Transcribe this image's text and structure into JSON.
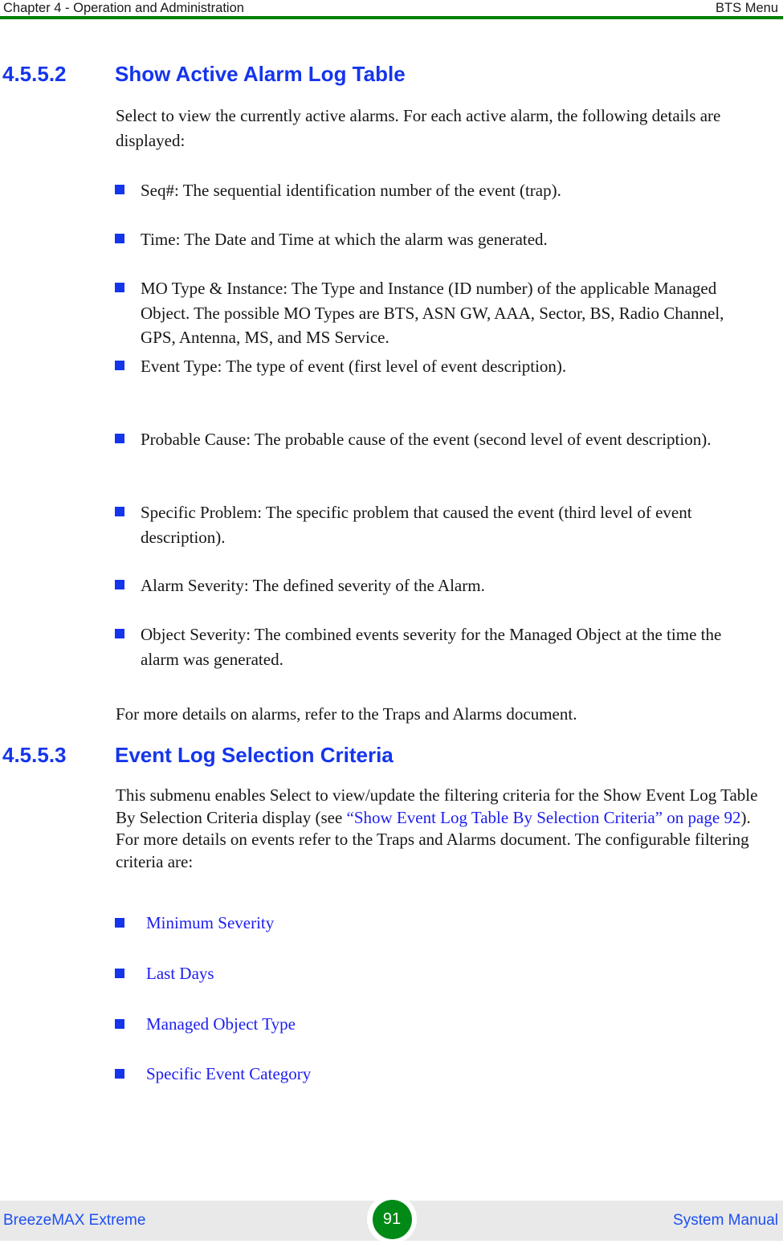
{
  "header": {
    "left": "Chapter 4 - Operation and Administration",
    "right": "BTS Menu",
    "rule_color": "#008000"
  },
  "footer": {
    "left": "BreezeMAX Extreme",
    "right": "System Manual",
    "page_number": "91",
    "badge_color": "#018a16",
    "band_color": "#e9e9e9",
    "link_color": "#1d4ff0"
  },
  "theme": {
    "heading_color": "#1435ec",
    "bullet_color": "#1435ec",
    "xref_color": "#1d1df0",
    "body_color": "#161616"
  },
  "sections": [
    {
      "number": "4.5.5.2",
      "title": "Show Active Alarm Log Table",
      "intro": "Select to view the currently active alarms. For each active alarm, the following details are displayed:",
      "bullets": [
        "Seq#: The sequential identification number of the event (trap).",
        "Time: The Date and Time at which the alarm was generated.",
        "MO Type & Instance: The Type and Instance (ID number) of the applicable Managed Object. The possible MO Types are BTS, ASN GW, AAA, Sector, BS, Radio Channel, GPS, Antenna, MS, and MS Service.",
        "Event Type: The type of event (first level of event description).",
        "Probable Cause: The probable cause of the event (second level of event description).",
        "Specific Problem: The specific problem that caused the event (third level of event description).",
        "Alarm Severity: The defined severity of the Alarm.",
        "Object Severity: The combined events severity for the Managed Object at the time the alarm was generated."
      ],
      "closing": "For more details on alarms, refer to the Traps and Alarms document."
    },
    {
      "number": "4.5.5.3",
      "title": "Event Log Selection Criteria",
      "paragraph_part1": "This submenu enables Select to view/update the filtering criteria for the Show Event Log Table By Selection Criteria display (see ",
      "paragraph_xref": "“Show Event Log Table By Selection Criteria” on page 92",
      "paragraph_part2": "). For more details on events refer to the Traps and Alarms document. The configurable filtering criteria are:",
      "link_bullets": [
        "Minimum Severity",
        "Last Days",
        "Managed Object Type",
        "Specific Event Category"
      ]
    }
  ]
}
